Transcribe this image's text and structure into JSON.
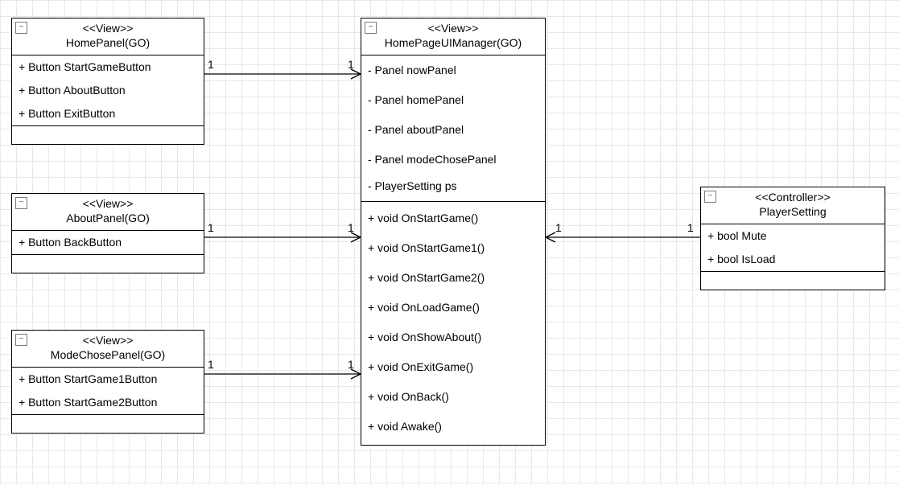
{
  "chart_data": {
    "type": "uml-class-diagram",
    "classes": [
      {
        "id": "HomePanel",
        "stereotype": "<<View>>",
        "name": "HomePanel(GO)",
        "attributes": [
          "+ Button StartGameButton",
          "+ Button AboutButton",
          "+ Button ExitButton"
        ],
        "methods": []
      },
      {
        "id": "AboutPanel",
        "stereotype": "<<View>>",
        "name": "AboutPanel(GO)",
        "attributes": [
          "+ Button BackButton"
        ],
        "methods": []
      },
      {
        "id": "ModeChosePanel",
        "stereotype": "<<View>>",
        "name": "ModeChosePanel(GO)",
        "attributes": [
          "+ Button StartGame1Button",
          "+ Button StartGame2Button"
        ],
        "methods": []
      },
      {
        "id": "HomePageUIManager",
        "stereotype": "<<View>>",
        "name": "HomePageUIManager(GO)",
        "attributes": [
          "- Panel nowPanel",
          "- Panel homePanel",
          "- Panel aboutPanel",
          "- Panel modeChosePanel",
          "- PlayerSetting ps"
        ],
        "methods": [
          "+ void OnStartGame()",
          "+ void OnStartGame1()",
          "+ void OnStartGame2()",
          "+ void OnLoadGame()",
          "+ void OnShowAbout()",
          "+ void OnExitGame()",
          "+ void OnBack()",
          "+ void Awake()"
        ]
      },
      {
        "id": "PlayerSetting",
        "stereotype": "<<Controller>>",
        "name": "PlayerSetting",
        "attributes": [
          "+ bool Mute",
          "+ bool IsLoad"
        ],
        "methods": []
      }
    ],
    "associations": [
      {
        "from": "HomePanel",
        "to": "HomePageUIManager",
        "from_mult": "1",
        "to_mult": "1"
      },
      {
        "from": "AboutPanel",
        "to": "HomePageUIManager",
        "from_mult": "1",
        "to_mult": "1"
      },
      {
        "from": "ModeChosePanel",
        "to": "HomePageUIManager",
        "from_mult": "1",
        "to_mult": "1"
      },
      {
        "from": "PlayerSetting",
        "to": "HomePageUIManager",
        "from_mult": "1",
        "to_mult": "1"
      }
    ]
  },
  "collapse_glyph": "−"
}
